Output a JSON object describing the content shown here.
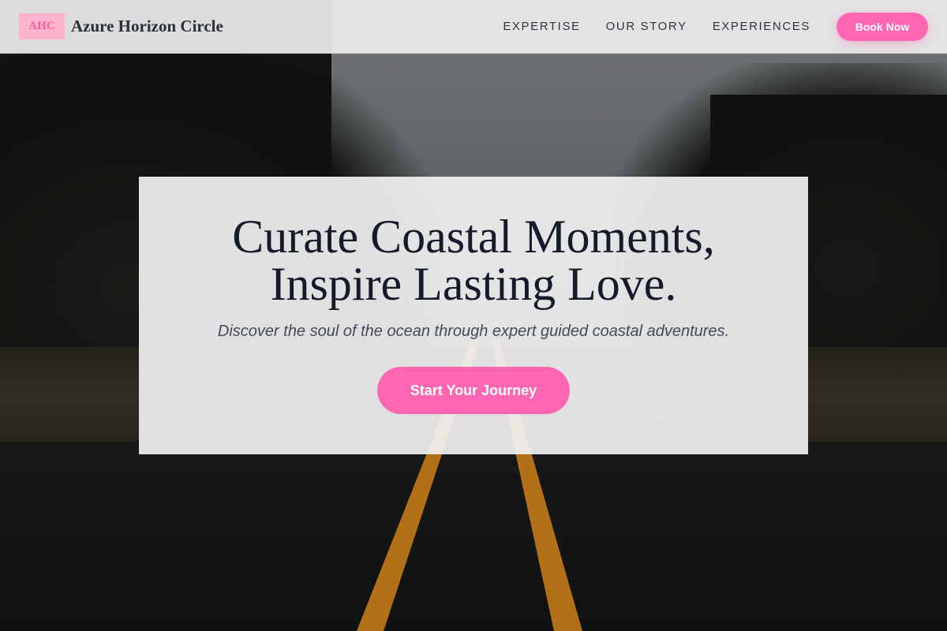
{
  "header": {
    "logo_text": "AHC",
    "brand_name": "Azure Horizon Circle",
    "nav": [
      {
        "label": "EXPERTISE"
      },
      {
        "label": "OUR STORY"
      },
      {
        "label": "EXPERIENCES"
      }
    ],
    "cta_label": "Book Now"
  },
  "hero": {
    "headline_line1": "Curate Coastal Moments,",
    "headline_line2": "Inspire Lasting Love.",
    "subtitle": "Discover the soul of the ocean through expert guided coastal adventures.",
    "cta_label": "Start Your Journey",
    "background_image": "road-through-trees-photo"
  },
  "colors": {
    "accent_pink": "#ff66b2",
    "logo_bg": "#ffb3cc",
    "logo_text": "#ff5a9d",
    "heading_text": "#161b2c",
    "header_bg": "#ececec",
    "lane_line_yellow": "#d98a1c"
  }
}
